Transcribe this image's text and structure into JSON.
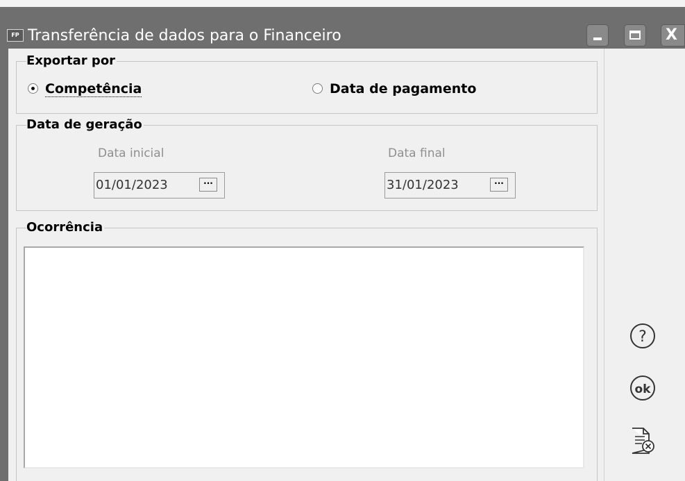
{
  "window": {
    "app_icon_text": "FP",
    "title": "Transferência de dados para o Financeiro",
    "controls": [
      "minimize-icon",
      "maximize-icon",
      "close-icon"
    ],
    "close_glyph": "X"
  },
  "export_group": {
    "legend": "Exportar por",
    "options": [
      {
        "label": "Competência",
        "selected": true
      },
      {
        "label": "Data de pagamento",
        "selected": false
      }
    ]
  },
  "date_group": {
    "legend": "Data de geração",
    "start": {
      "label": "Data inicial",
      "value": "01/01/2023",
      "button": "···",
      "enabled": false
    },
    "end": {
      "label": "Data final",
      "value": "31/01/2023",
      "button": "···",
      "enabled": false
    }
  },
  "occurrence_group": {
    "legend": "Ocorrência",
    "text": ""
  },
  "side_buttons": [
    {
      "name": "help",
      "icon": "help-icon",
      "glyph": "?"
    },
    {
      "name": "ok",
      "icon": "ok-icon",
      "glyph": "ok"
    },
    {
      "name": "cancel",
      "icon": "cancel-document-icon"
    }
  ],
  "colors": {
    "titlebar": "#6f6f6f",
    "background": "#f0f0f0",
    "disabled_text": "#8f8f8f"
  }
}
